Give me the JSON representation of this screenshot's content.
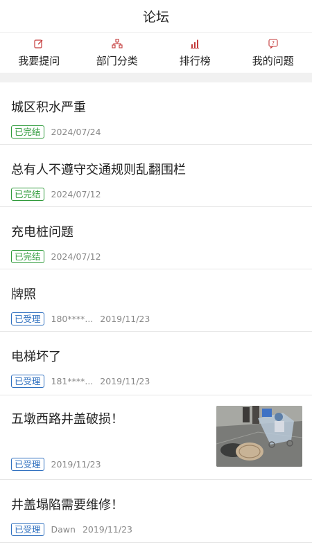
{
  "header": {
    "title": "论坛"
  },
  "tabs": [
    {
      "label": "我要提问",
      "icon": "edit-icon"
    },
    {
      "label": "部门分类",
      "icon": "org-chart-icon"
    },
    {
      "label": "排行榜",
      "icon": "bar-chart-icon"
    },
    {
      "label": "我的问题",
      "icon": "question-icon"
    }
  ],
  "posts": [
    {
      "title": "城区积水严重",
      "status": "已完结",
      "status_color": "#2e9a3a",
      "date": "2024/07/24"
    },
    {
      "title": "总有人不遵守交通规则乱翻围栏",
      "status": "已完结",
      "status_color": "#2e9a3a",
      "date": "2024/07/12"
    },
    {
      "title": "充电桩问题",
      "status": "已完结",
      "status_color": "#2e9a3a",
      "date": "2024/07/12"
    },
    {
      "title": "牌照",
      "status": "已受理",
      "status_color": "#2e6fbf",
      "user": "180****...",
      "date": "2019/11/23"
    },
    {
      "title": "电梯坏了",
      "status": "已受理",
      "status_color": "#2e6fbf",
      "user": "181****...",
      "date": "2019/11/23"
    },
    {
      "title": "五墩西路井盖破损！",
      "status": "已受理",
      "status_color": "#2e6fbf",
      "date": "2019/11/23",
      "thumbnail": "broken-manhole-photo"
    },
    {
      "title": "井盖塌陷需要维修！",
      "status": "已受理",
      "status_color": "#2e6fbf",
      "user": "Dawn",
      "date": "2019/11/23"
    }
  ]
}
